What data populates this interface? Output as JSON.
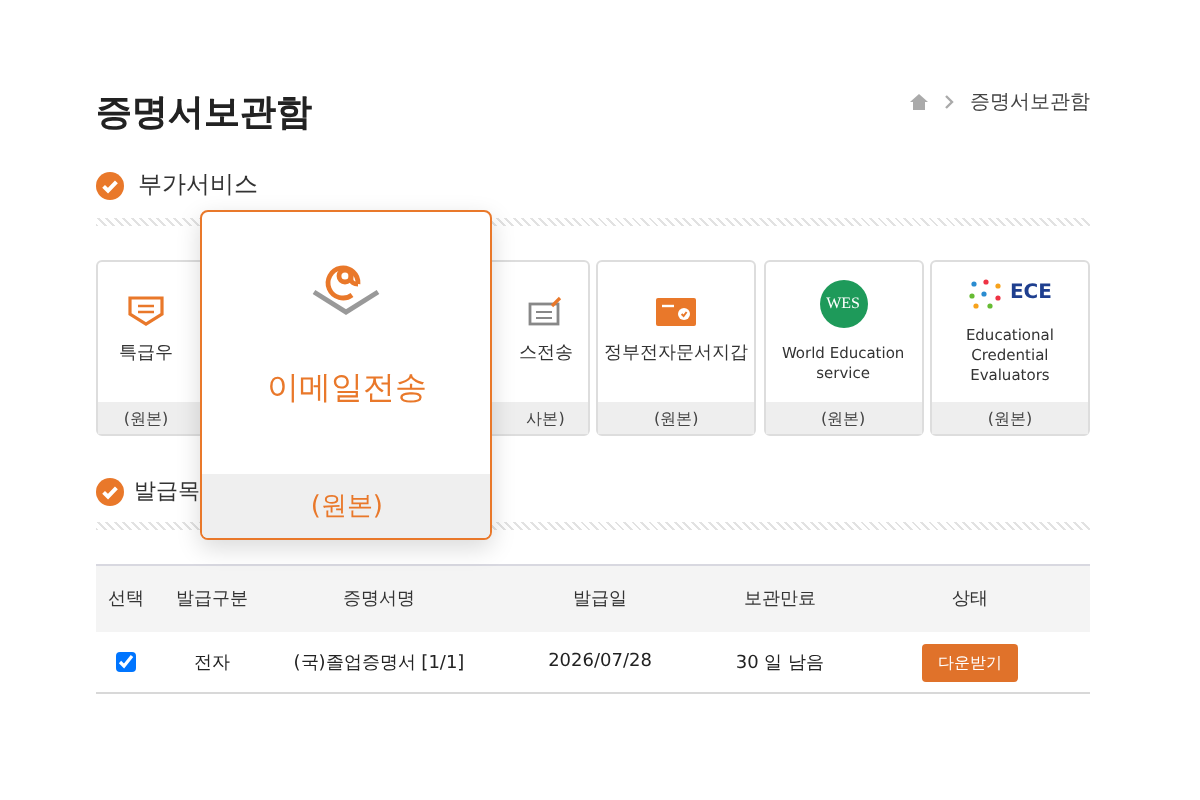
{
  "page": {
    "title": "증명서보관함",
    "breadcrumb": "증명서보관함"
  },
  "extra_services": {
    "heading": "부가서비스",
    "cards": [
      {
        "kind": "envelope",
        "label": "특급우",
        "copy_type": "(원본)",
        "hovered": false
      },
      {
        "kind": "email",
        "label": "이메일전송",
        "copy_type": "(원본)",
        "hovered": true
      },
      {
        "kind": "fax",
        "label": "스전송",
        "copy_type": "사본)",
        "hovered": false
      },
      {
        "kind": "wallet",
        "label": "정부전자문서지갑",
        "copy_type": "(원본)",
        "hovered": false
      },
      {
        "kind": "wes",
        "logo_text": "WES",
        "label": "World Education service",
        "copy_type": "(원본)",
        "hovered": false
      },
      {
        "kind": "ece",
        "logo_text": "ECE",
        "label": "Educational Credential Evaluators",
        "copy_type": "(원본)",
        "hovered": false
      }
    ]
  },
  "issued": {
    "heading": "발급목",
    "columns": [
      "선택",
      "발급구분",
      "증명서명",
      "발급일",
      "보관만료",
      "상태"
    ],
    "rows": [
      {
        "checked": true,
        "type": "전자",
        "name": "(국)졸업증명서 [1/1]",
        "issued": "2026/07/28",
        "expiry": "30 일 남음",
        "action": "다운받기"
      }
    ]
  }
}
